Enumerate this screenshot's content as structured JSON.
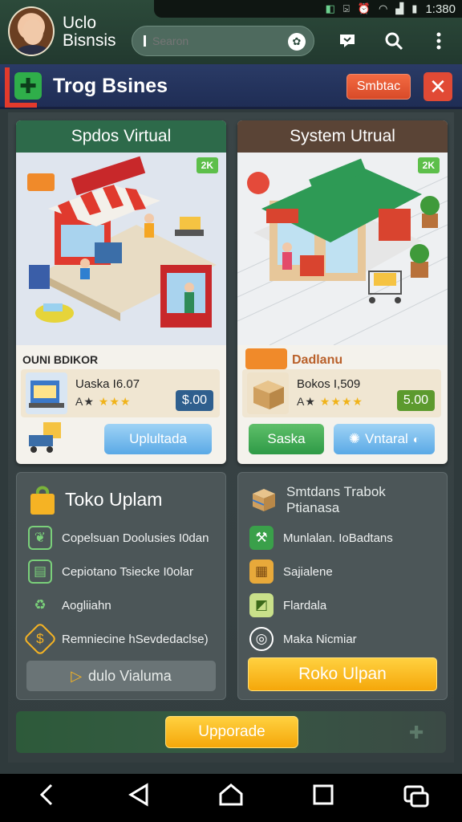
{
  "status_bar": {
    "time": "1:380",
    "icons": [
      "app-icon",
      "share-icon",
      "alarm-icon",
      "wifi-icon",
      "signal-icon",
      "battery-icon"
    ]
  },
  "header": {
    "brand_line1": "Uclo",
    "brand_line2": "Bisnsis",
    "search_placeholder": "Searon",
    "icons": [
      "mic-icon",
      "chat-icon",
      "search-icon",
      "more-icon"
    ]
  },
  "titlebar": {
    "title": "Trog Bsines",
    "action_label": "Smbtac",
    "close_label": "✕"
  },
  "colors": {
    "accent_green": "#2e9a55",
    "accent_orange": "#f5a70a",
    "accent_red": "#e14a35",
    "accent_blue": "#5aa9e6"
  },
  "cards": [
    {
      "header": "Spdos Virtual",
      "badge": "2K",
      "subtitle": "OUNI BDIKOR",
      "item_name": "Uaska I6.07",
      "item_rating": "A★",
      "item_stars": "★★★",
      "price": "$.00",
      "button_label": "Uplultada"
    },
    {
      "header": "System Utrual",
      "badge": "2K",
      "subtitle": "Dadlanu",
      "item_name": "Bokos I,509",
      "item_rating": "A★",
      "item_stars": "★★★★",
      "price": "5.00",
      "button_left_label": "Saska",
      "button_right_label": "Vntaral"
    }
  ],
  "lists": [
    {
      "title": "Toko Uplam",
      "items": [
        "Copelsuan Doolusies I0dan",
        "Cepiotano Tsiecke I0olar",
        "Aogliiahn",
        "Remniecine hSevdedaclse)"
      ],
      "button_label": "dulo Vialuma"
    },
    {
      "title": "Smtdans Trabok Ptianasa",
      "items": [
        "Munlalan. IoBadtans",
        "Sajialene",
        "Flardala",
        "Maka Nicmiar"
      ],
      "button_label": "Roko Ulpan"
    }
  ],
  "upgrade": {
    "button_label": "Upporade"
  },
  "navbar": {
    "icons": [
      "back-icon",
      "triangle-back-icon",
      "home-icon",
      "recents-icon",
      "screenshot-icon"
    ]
  }
}
